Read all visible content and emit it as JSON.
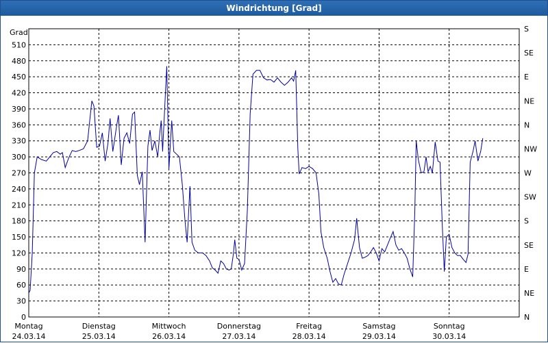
{
  "window": {
    "title": "Windrichtung [Grad]"
  },
  "chart_data": {
    "type": "line",
    "title": "Windrichtung [Grad]",
    "ylabel": "Grad",
    "ylim": [
      0,
      540
    ],
    "yticks": [
      0,
      30,
      60,
      90,
      120,
      150,
      180,
      210,
      240,
      270,
      300,
      330,
      360,
      390,
      420,
      450,
      480,
      510
    ],
    "right_axis": {
      "labels": [
        "N",
        "NE",
        "E",
        "SE",
        "S",
        "SW",
        "W",
        "NW",
        "N",
        "NE",
        "E",
        "SE",
        "S"
      ],
      "values": [
        0,
        45,
        90,
        135,
        180,
        225,
        270,
        315,
        360,
        405,
        450,
        495,
        540
      ]
    },
    "x_categories": [
      {
        "day": "Montag",
        "date": "24.03.14"
      },
      {
        "day": "Dienstag",
        "date": "25.03.14"
      },
      {
        "day": "Mittwoch",
        "date": "26.03.14"
      },
      {
        "day": "Donnerstag",
        "date": "27.03.14"
      },
      {
        "day": "Freitag",
        "date": "28.03.14"
      },
      {
        "day": "Samstag",
        "date": "29.03.14"
      },
      {
        "day": "Sonntag",
        "date": "30.03.14"
      }
    ],
    "grid": true,
    "series": [
      {
        "color": "#00009c",
        "points": [
          [
            0.0,
            45
          ],
          [
            0.02,
            50
          ],
          [
            0.05,
            120
          ],
          [
            0.08,
            270
          ],
          [
            0.12,
            300
          ],
          [
            0.18,
            295
          ],
          [
            0.25,
            292
          ],
          [
            0.3,
            300
          ],
          [
            0.35,
            308
          ],
          [
            0.4,
            310
          ],
          [
            0.45,
            305
          ],
          [
            0.48,
            308
          ],
          [
            0.52,
            280
          ],
          [
            0.57,
            298
          ],
          [
            0.62,
            312
          ],
          [
            0.67,
            310
          ],
          [
            0.72,
            312
          ],
          [
            0.78,
            315
          ],
          [
            0.84,
            330
          ],
          [
            0.88,
            380
          ],
          [
            0.9,
            405
          ],
          [
            0.93,
            395
          ],
          [
            0.97,
            318
          ],
          [
            1.01,
            320
          ],
          [
            1.05,
            345
          ],
          [
            1.09,
            292
          ],
          [
            1.13,
            325
          ],
          [
            1.16,
            372
          ],
          [
            1.2,
            310
          ],
          [
            1.25,
            355
          ],
          [
            1.28,
            378
          ],
          [
            1.32,
            285
          ],
          [
            1.36,
            335
          ],
          [
            1.4,
            345
          ],
          [
            1.44,
            325
          ],
          [
            1.48,
            380
          ],
          [
            1.51,
            384
          ],
          [
            1.55,
            265
          ],
          [
            1.58,
            248
          ],
          [
            1.62,
            272
          ],
          [
            1.66,
            140
          ],
          [
            1.7,
            320
          ],
          [
            1.73,
            350
          ],
          [
            1.76,
            312
          ],
          [
            1.8,
            330
          ],
          [
            1.84,
            300
          ],
          [
            1.87,
            345
          ],
          [
            1.89,
            368
          ],
          [
            1.91,
            310
          ],
          [
            1.95,
            420
          ],
          [
            1.97,
            470
          ],
          [
            2.0,
            278
          ],
          [
            2.04,
            368
          ],
          [
            2.07,
            310
          ],
          [
            2.11,
            305
          ],
          [
            2.15,
            300
          ],
          [
            2.19,
            250
          ],
          [
            2.23,
            180
          ],
          [
            2.26,
            140
          ],
          [
            2.3,
            245
          ],
          [
            2.33,
            140
          ],
          [
            2.37,
            125
          ],
          [
            2.42,
            120
          ],
          [
            2.48,
            120
          ],
          [
            2.53,
            115
          ],
          [
            2.58,
            105
          ],
          [
            2.62,
            92
          ],
          [
            2.66,
            88
          ],
          [
            2.7,
            82
          ],
          [
            2.74,
            105
          ],
          [
            2.78,
            100
          ],
          [
            2.82,
            90
          ],
          [
            2.86,
            88
          ],
          [
            2.89,
            90
          ],
          [
            2.92,
            118
          ],
          [
            2.94,
            145
          ],
          [
            2.97,
            110
          ],
          [
            3.0,
            108
          ],
          [
            3.04,
            88
          ],
          [
            3.08,
            100
          ],
          [
            3.12,
            200
          ],
          [
            3.16,
            380
          ],
          [
            3.2,
            455
          ],
          [
            3.25,
            462
          ],
          [
            3.3,
            462
          ],
          [
            3.35,
            448
          ],
          [
            3.4,
            444
          ],
          [
            3.45,
            445
          ],
          [
            3.5,
            440
          ],
          [
            3.55,
            448
          ],
          [
            3.6,
            440
          ],
          [
            3.65,
            434
          ],
          [
            3.7,
            440
          ],
          [
            3.75,
            448
          ],
          [
            3.78,
            442
          ],
          [
            3.81,
            462
          ],
          [
            3.84,
            315
          ],
          [
            3.86,
            268
          ],
          [
            3.9,
            280
          ],
          [
            3.95,
            278
          ],
          [
            4.0,
            282
          ],
          [
            4.05,
            278
          ],
          [
            4.1,
            270
          ],
          [
            4.14,
            230
          ],
          [
            4.17,
            160
          ],
          [
            4.21,
            130
          ],
          [
            4.26,
            110
          ],
          [
            4.3,
            85
          ],
          [
            4.34,
            65
          ],
          [
            4.38,
            72
          ],
          [
            4.42,
            62
          ],
          [
            4.46,
            60
          ],
          [
            4.5,
            80
          ],
          [
            4.55,
            100
          ],
          [
            4.6,
            120
          ],
          [
            4.65,
            145
          ],
          [
            4.68,
            185
          ],
          [
            4.72,
            130
          ],
          [
            4.76,
            110
          ],
          [
            4.8,
            112
          ],
          [
            4.84,
            115
          ],
          [
            4.88,
            122
          ],
          [
            4.92,
            130
          ],
          [
            4.96,
            120
          ],
          [
            5.0,
            105
          ],
          [
            5.04,
            128
          ],
          [
            5.08,
            122
          ],
          [
            5.12,
            135
          ],
          [
            5.16,
            148
          ],
          [
            5.2,
            160
          ],
          [
            5.24,
            135
          ],
          [
            5.28,
            125
          ],
          [
            5.32,
            128
          ],
          [
            5.36,
            120
          ],
          [
            5.4,
            110
          ],
          [
            5.44,
            90
          ],
          [
            5.48,
            75
          ],
          [
            5.51,
            200
          ],
          [
            5.53,
            330
          ],
          [
            5.56,
            295
          ],
          [
            5.6,
            270
          ],
          [
            5.64,
            272
          ],
          [
            5.67,
            300
          ],
          [
            5.7,
            272
          ],
          [
            5.73,
            282
          ],
          [
            5.76,
            270
          ],
          [
            5.8,
            328
          ],
          [
            5.84,
            292
          ],
          [
            5.87,
            290
          ],
          [
            5.9,
            178
          ],
          [
            5.93,
            85
          ],
          [
            5.96,
            150
          ],
          [
            6.0,
            155
          ],
          [
            6.04,
            130
          ],
          [
            6.08,
            120
          ],
          [
            6.12,
            115
          ],
          [
            6.16,
            115
          ],
          [
            6.2,
            108
          ],
          [
            6.24,
            102
          ],
          [
            6.27,
            118
          ],
          [
            6.3,
            290
          ],
          [
            6.34,
            310
          ],
          [
            6.37,
            330
          ],
          [
            6.41,
            292
          ],
          [
            6.45,
            310
          ],
          [
            6.48,
            335
          ]
        ]
      }
    ]
  }
}
